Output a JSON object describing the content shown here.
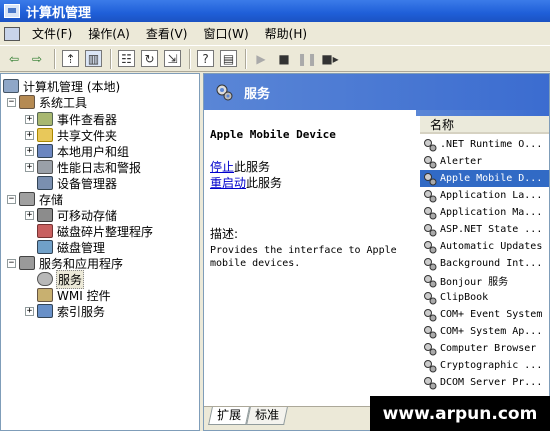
{
  "window": {
    "title": "计算机管理"
  },
  "menu": [
    "文件(F)",
    "操作(A)",
    "查看(V)",
    "窗口(W)",
    "帮助(H)"
  ],
  "tree": {
    "root": "计算机管理 (本地)",
    "system_tools": "系统工具",
    "event_viewer": "事件查看器",
    "shared_folders": "共享文件夹",
    "local_users": "本地用户和组",
    "perf_logs": "性能日志和警报",
    "device_manager": "设备管理器",
    "storage": "存储",
    "removable": "可移动存储",
    "defrag": "磁盘碎片整理程序",
    "disk_mgmt": "磁盘管理",
    "services_apps": "服务和应用程序",
    "services": "服务",
    "wmi": "WMI 控件",
    "indexing": "索引服务"
  },
  "pane": {
    "title": "服务",
    "service_name": "Apple Mobile Device",
    "stop_link": "停止",
    "stop_suffix": "此服务",
    "restart_link": "重启动",
    "restart_suffix": "此服务",
    "desc_label": "描述:",
    "desc_text": "Provides the interface to Apple mobile devices."
  },
  "list": {
    "column": "名称",
    "selected_index": 2,
    "rows": [
      ".NET Runtime O...",
      "Alerter",
      "Apple Mobile D...",
      "Application La...",
      "Application Ma...",
      "ASP.NET State ...",
      "Automatic Updates",
      "Background Int...",
      "Bonjour 服务",
      "ClipBook",
      "COM+ Event System",
      "COM+ System Ap...",
      "Computer Browser",
      "Cryptographic ...",
      "DCOM Server Pr..."
    ]
  },
  "tabs": {
    "extended": "扩展",
    "standard": "标准"
  },
  "watermark": "www.arpun.com"
}
